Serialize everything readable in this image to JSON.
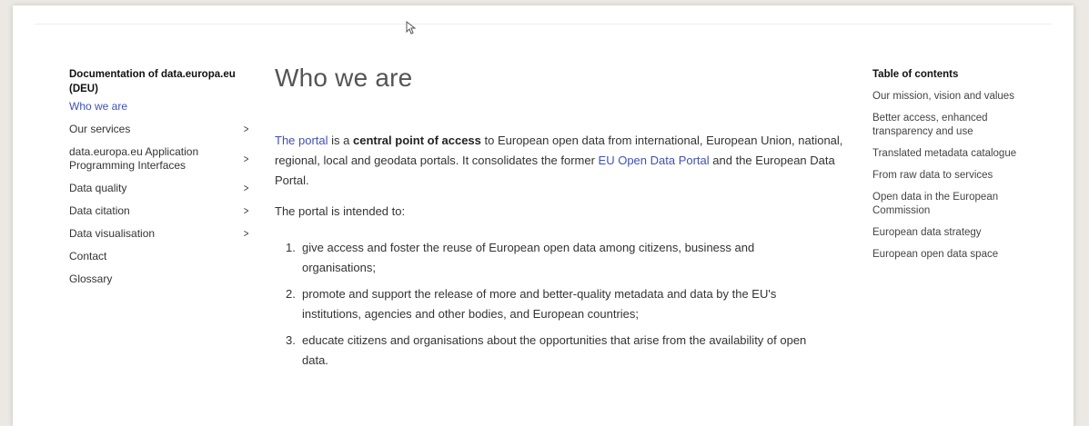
{
  "sidebar": {
    "title": "Documentation of data.europa.eu (DEU)",
    "items": [
      {
        "label": "Who we are",
        "active": true,
        "chevron": false
      },
      {
        "label": "Our services",
        "active": false,
        "chevron": true
      },
      {
        "label": "data.europa.eu Application Programming Interfaces",
        "active": false,
        "chevron": true
      },
      {
        "label": "Data quality",
        "active": false,
        "chevron": true
      },
      {
        "label": "Data citation",
        "active": false,
        "chevron": true
      },
      {
        "label": "Data visualisation",
        "active": false,
        "chevron": true
      },
      {
        "label": "Contact",
        "active": false,
        "chevron": false
      },
      {
        "label": "Glossary",
        "active": false,
        "chevron": false
      }
    ],
    "chevron_glyph": ">"
  },
  "main": {
    "title": "Who we are",
    "intro": {
      "link1": "The portal",
      "text1": " is a ",
      "bold": "central point of access",
      "text2": " to European open data from international, European Union, national, regional, local and geodata portals. It consolidates the former ",
      "link2": "EU Open Data Portal",
      "text3": " and the European Data Portal."
    },
    "intended": "The portal is intended to:",
    "list": [
      {
        "num": "1.",
        "text": "give access and foster the reuse of European open data among citizens, business and organisations;"
      },
      {
        "num": "2.",
        "text": "promote and support the release of more and better-quality metadata and data by the EU's institutions, agencies and other bodies, and European countries;"
      },
      {
        "num": "3.",
        "text": "educate citizens and organisations about the opportunities that arise from the availability of open data."
      }
    ]
  },
  "toc": {
    "title": "Table of contents",
    "items": [
      "Our mission, vision and values",
      "Better access, enhanced transparency and use",
      "Translated metadata catalogue",
      "From raw data to services",
      "Open data in the European Commission",
      "European data strategy",
      "European open data space"
    ]
  },
  "colors": {
    "link": "#3f51b5",
    "text": "#333333",
    "background": "#ffffff"
  },
  "icons": {
    "cursor": "mouse-pointer-icon",
    "chevron": "chevron-right-icon"
  }
}
